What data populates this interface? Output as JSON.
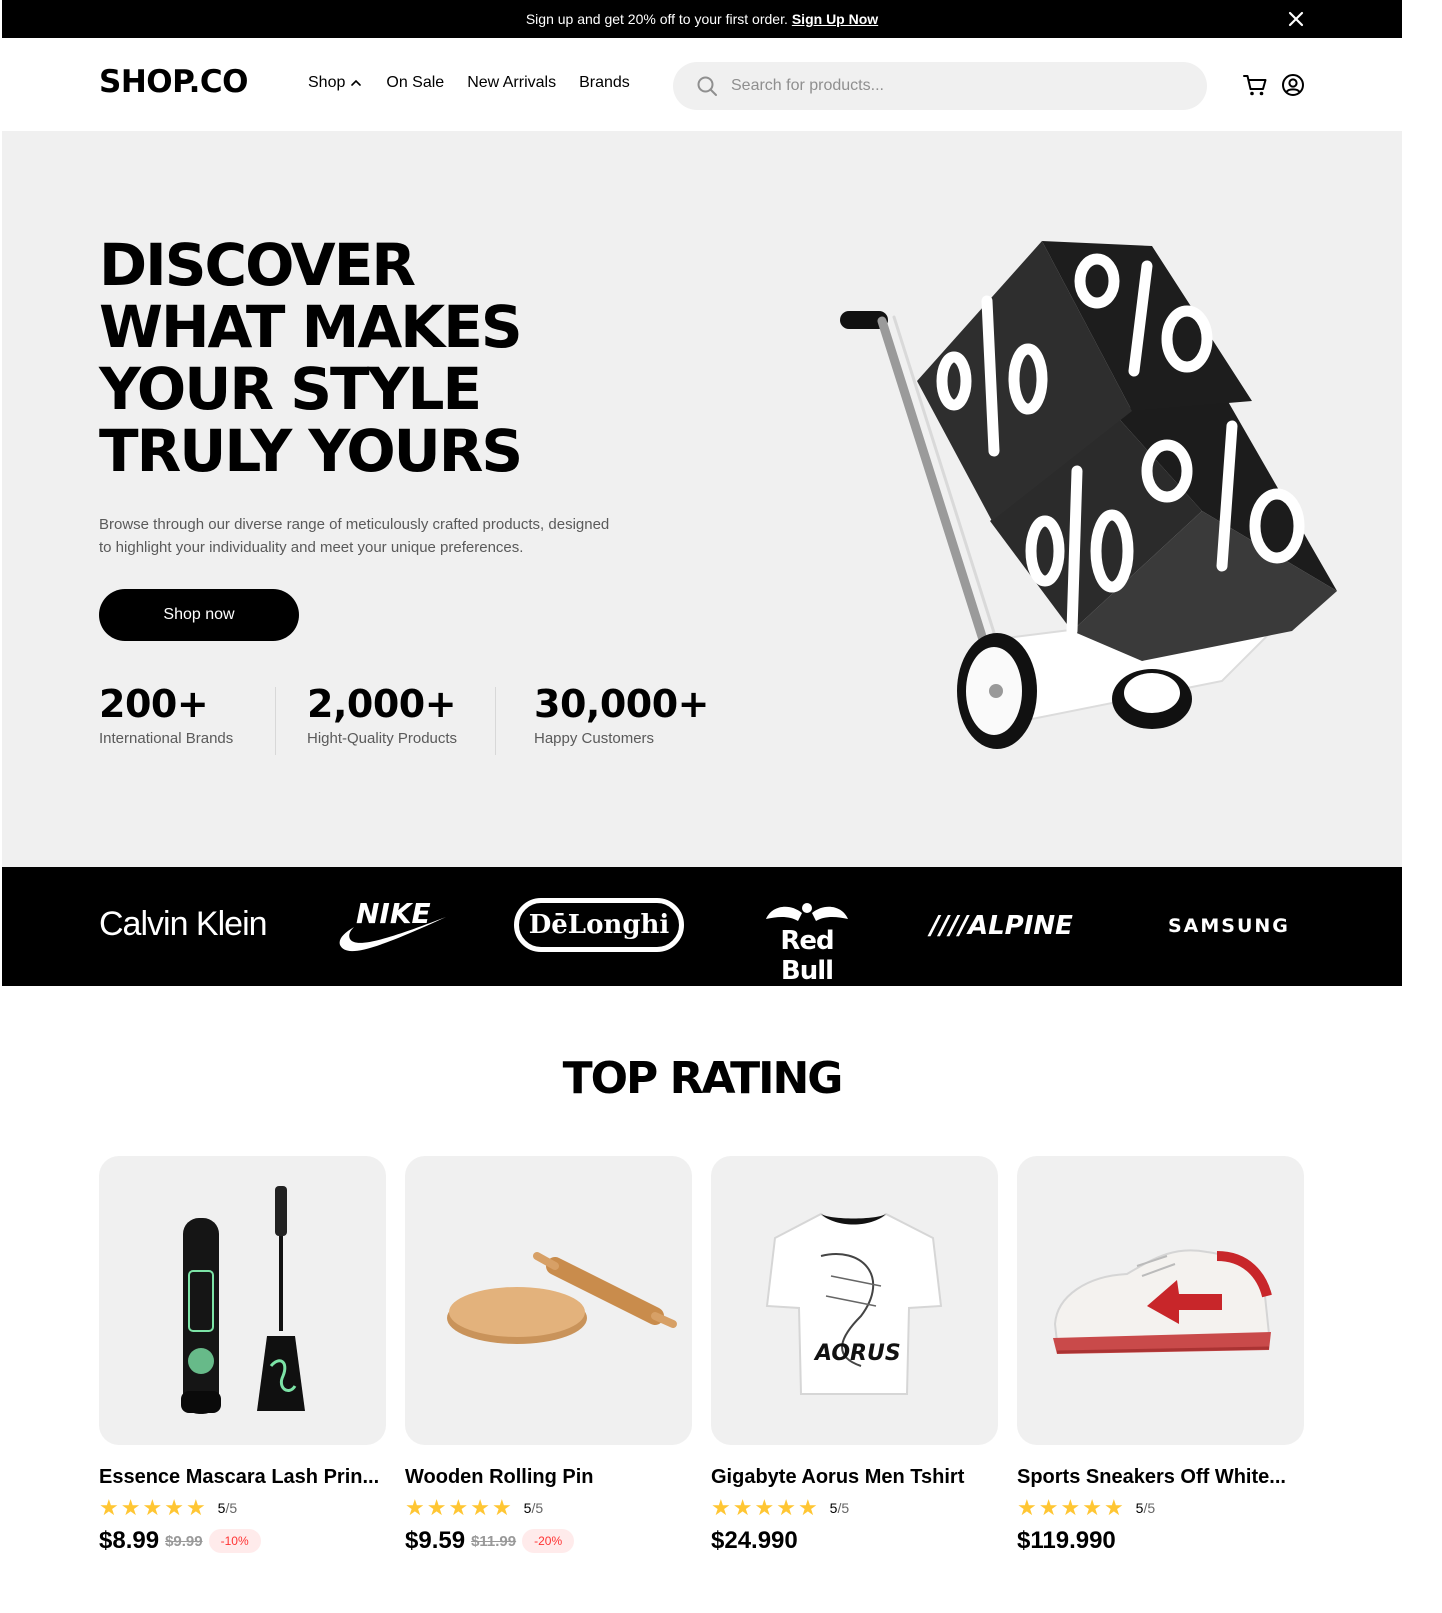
{
  "promo": {
    "text": "Sign up and get 20% off to your first order.",
    "link": "Sign Up Now"
  },
  "nav": {
    "logo": "SHOP.CO",
    "menu": [
      "Shop",
      "On Sale",
      "New Arrivals",
      "Brands"
    ],
    "search_placeholder": "Search for products..."
  },
  "hero": {
    "title_lines": [
      "DISCOVER",
      "WHAT MAKES",
      "YOUR STYLE",
      "TRULY YOURS"
    ],
    "description": "Browse through our diverse range of meticulously crafted products, designed to highlight your individuality and meet your unique preferences.",
    "cta": "Shop now",
    "stats": [
      {
        "value": "200+",
        "label": "International Brands"
      },
      {
        "value": "2,000+",
        "label": "Hight-Quality Products"
      },
      {
        "value": "30,000+",
        "label": "Happy Customers"
      }
    ]
  },
  "brands": [
    "Calvin Klein",
    "NIKE",
    "DēLonghi",
    "Red Bull",
    "ALPINE",
    "SAMSUNG"
  ],
  "top_rating": {
    "title": "TOP RATING",
    "products": [
      {
        "name": "Essence Mascara Lash Prin...",
        "rating": "5",
        "rating_max": "/5",
        "price": "$8.99",
        "old_price": "$9.99",
        "discount": "-10%"
      },
      {
        "name": "Wooden Rolling Pin",
        "rating": "5",
        "rating_max": "/5",
        "price": "$9.59",
        "old_price": "$11.99",
        "discount": "-20%"
      },
      {
        "name": "Gigabyte Aorus Men Tshirt",
        "rating": "5",
        "rating_max": "/5",
        "price": "$24.990",
        "old_price": "",
        "discount": ""
      },
      {
        "name": "Sports Sneakers Off White...",
        "rating": "5",
        "rating_max": "/5",
        "price": "$119.990",
        "old_price": "",
        "discount": ""
      }
    ]
  },
  "colors": {
    "accent": "#000000",
    "hero_bg": "#f0f0f0",
    "star": "#ffc633",
    "discount_text": "#ff3333",
    "discount_bg": "#ffebeb"
  }
}
